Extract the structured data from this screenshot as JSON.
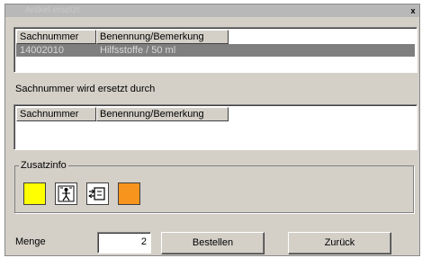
{
  "window": {
    "title": "Artikel ersetzt",
    "close_label": "x"
  },
  "list_top": {
    "columns": [
      "Sachnummer",
      "Benennung/Bemerkung"
    ],
    "rows": [
      {
        "sachnummer": "14002010",
        "benennung": "Hilfsstoffe / 50 ml"
      }
    ]
  },
  "replaced_label": "Sachnummer wird ersetzt durch",
  "list_bottom": {
    "columns": [
      "Sachnummer",
      "Benennung/Bemerkung"
    ]
  },
  "zusatzinfo": {
    "label": "Zusatzinfo",
    "icons": [
      {
        "name": "yellow-indicator-icon",
        "color": "#ffff00"
      },
      {
        "name": "person-table-icon"
      },
      {
        "name": "device-arrows-icon"
      },
      {
        "name": "orange-indicator-icon",
        "color": "#f7941d"
      }
    ]
  },
  "menge": {
    "label": "Menge",
    "value": "2"
  },
  "buttons": {
    "bestellen": "Bestellen",
    "zurueck": "Zurück"
  }
}
